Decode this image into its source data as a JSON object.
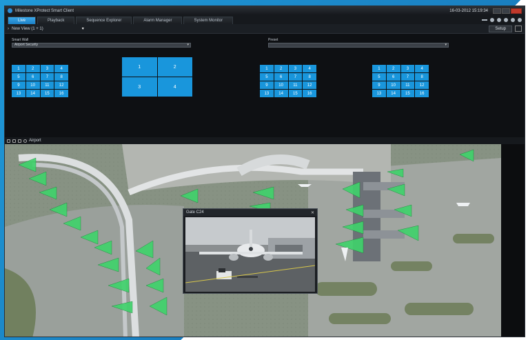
{
  "window": {
    "title": "Milestone XProtect Smart Client",
    "datetime": "16-03-2012 15:19:34"
  },
  "tabs": [
    "Live",
    "Playback",
    "Sequence Explorer",
    "Alarm Manager",
    "System Monitor"
  ],
  "active_tab": "Live",
  "viewbar": {
    "view_name": "New View (1 + 1)",
    "setup_label": "Setup"
  },
  "smart_wall": {
    "label": "Smart Wall",
    "selected": "Airport Security"
  },
  "preset": {
    "label": "Preset",
    "selected": ""
  },
  "monitor_grids": {
    "grid_a": [
      "1",
      "2",
      "3",
      "4",
      "5",
      "6",
      "7",
      "8",
      "9",
      "10",
      "11",
      "12",
      "13",
      "14",
      "15",
      "16"
    ],
    "grid_b": [
      "1",
      "2",
      "3",
      "4"
    ],
    "grid_c": [
      "1",
      "2",
      "3",
      "4",
      "5",
      "6",
      "7",
      "8",
      "9",
      "10",
      "11",
      "12",
      "13",
      "14",
      "15",
      "16"
    ],
    "grid_d": [
      "1",
      "2",
      "3",
      "4",
      "5",
      "6",
      "7",
      "8",
      "9",
      "10",
      "11",
      "12",
      "13",
      "14",
      "15",
      "16"
    ]
  },
  "map": {
    "breadcrumb": "Airport"
  },
  "camera_popup": {
    "title": "Gate C24"
  },
  "colors": {
    "accent": "#1996dc",
    "camera_cone": "#3fd36b",
    "background": "#0d0f12"
  }
}
